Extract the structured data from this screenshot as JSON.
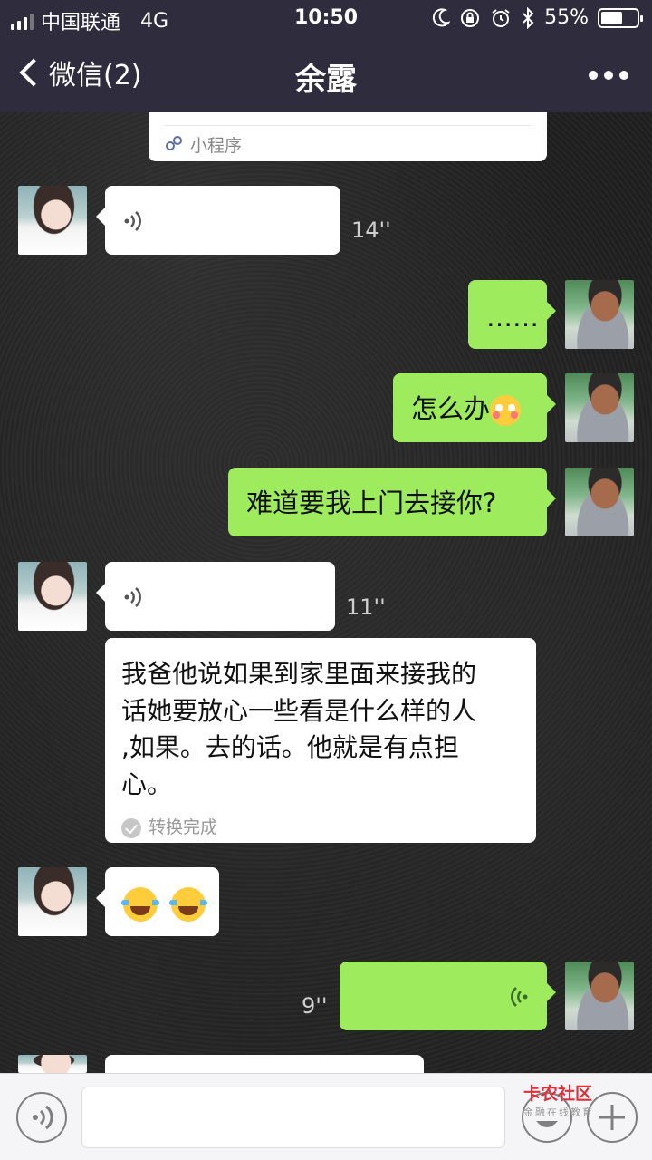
{
  "status_bar": {
    "carrier": "中国联通",
    "network": "4G",
    "time": "10:50",
    "battery": "55%"
  },
  "nav": {
    "back_label": "微信(2)",
    "title": "余露"
  },
  "mini_program": {
    "label": "小程序"
  },
  "messages": {
    "voice1": {
      "duration": "14''"
    },
    "me1": {
      "text": "……"
    },
    "me2": {
      "text": "怎么办"
    },
    "me3": {
      "text": "难道要我上门去接你?"
    },
    "voice2": {
      "duration": "11''"
    },
    "transcript": {
      "line1": "我爸他说如果到家里面来接我的",
      "line2": "话她要放心一些看是什么样的人",
      "line3": ",如果。去的话。他就是有点担",
      "line4": "心。",
      "status": "转换完成"
    },
    "voice3": {
      "duration": "9''"
    }
  },
  "watermark": {
    "title": "卡农社区",
    "subtitle": "金融在线教育"
  },
  "colors": {
    "nav_bg": "#2f2c3e",
    "my_bubble": "#9feb5e",
    "their_bubble": "#ffffff"
  },
  "icons": [
    "signal-icon",
    "moon-icon",
    "rotation-lock-icon",
    "alarm-icon",
    "bluetooth-icon",
    "battery-icon",
    "back-chevron-icon",
    "more-icon",
    "voice-icon",
    "miniprogram-icon",
    "check-icon",
    "emoji-icon",
    "plus-icon"
  ]
}
